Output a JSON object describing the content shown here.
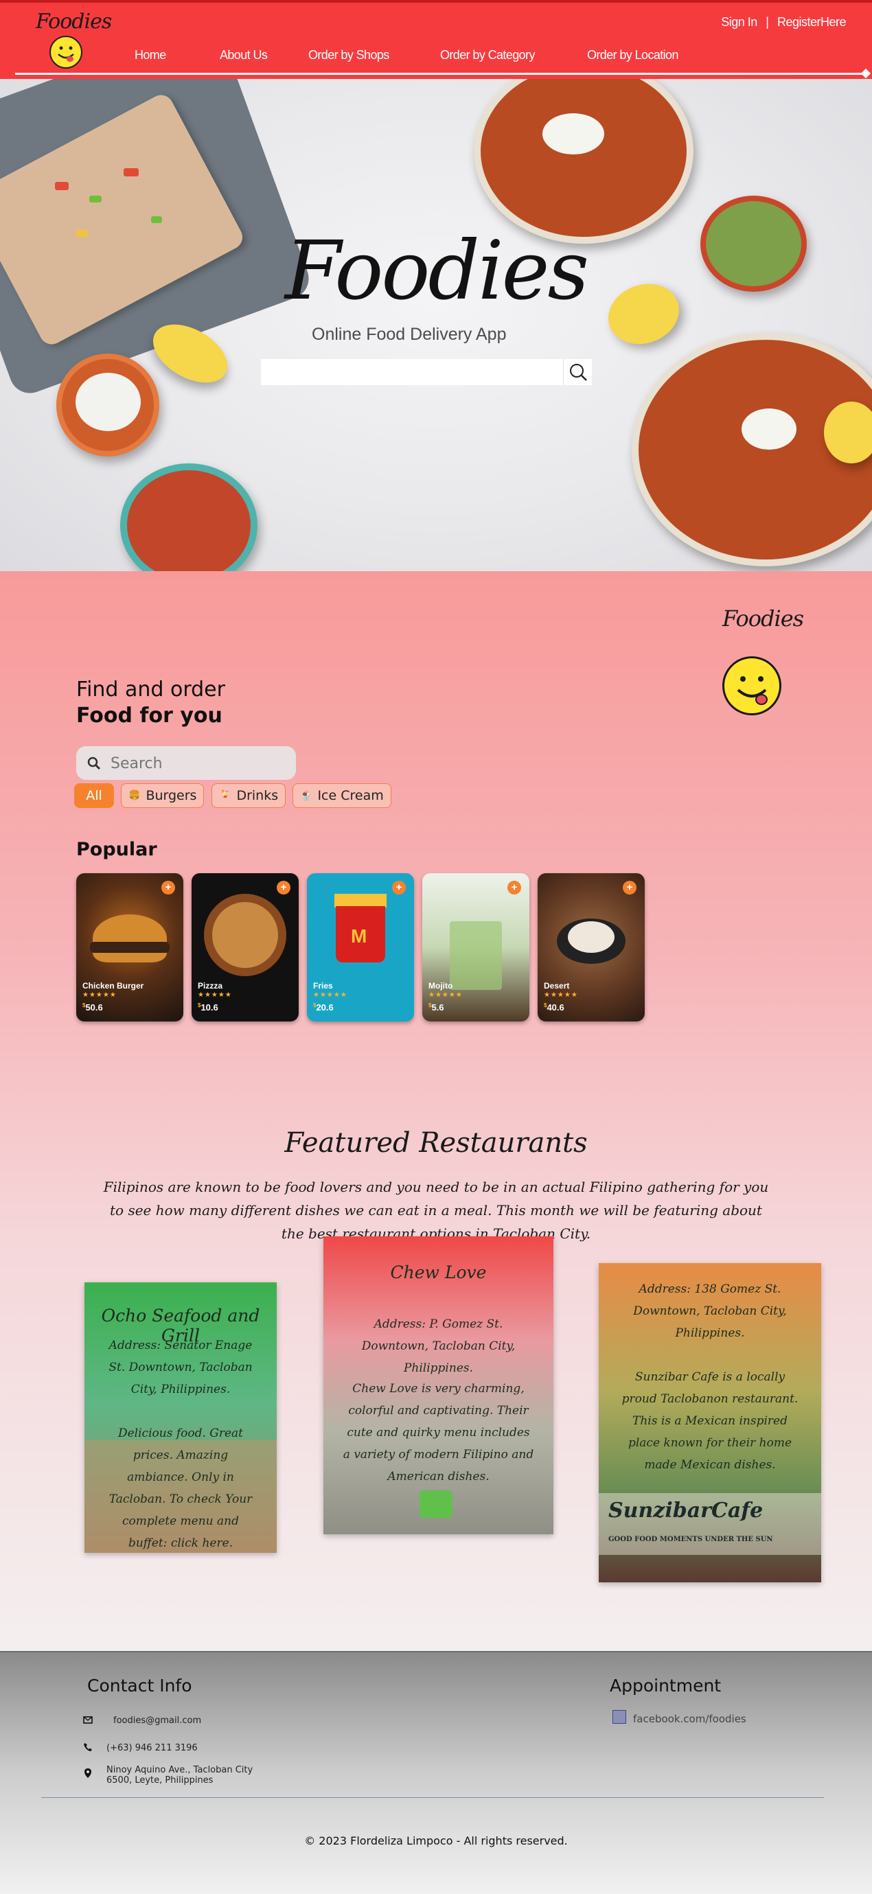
{
  "header": {
    "logo_text": "Foodies",
    "sign_in": "Sign In",
    "separator": "|",
    "register": "RegisterHere",
    "nav": [
      "Home",
      "About Us",
      "Order by Shops",
      "Order by Category",
      "Order by Location"
    ]
  },
  "hero": {
    "title": "Foodies",
    "subtitle": "Online Food Delivery App",
    "search_value": ""
  },
  "find": {
    "brand": "Foodies",
    "line1": "Find and order",
    "line2": "Food for you",
    "search_placeholder": "Search",
    "categories": [
      {
        "label": "All",
        "active": true
      },
      {
        "label": "Burgers",
        "active": false
      },
      {
        "label": "Drinks",
        "active": false
      },
      {
        "label": "Ice Cream",
        "active": false
      }
    ],
    "popular_title": "Popular",
    "items": [
      {
        "name": "Chicken Burger",
        "price": "50.6",
        "currency": "$",
        "plus": "+",
        "stars": "★★★★★"
      },
      {
        "name": "Pizzza",
        "price": "10.6",
        "currency": "$",
        "plus": "+",
        "stars": "★★★★★"
      },
      {
        "name": "Fries",
        "price": "20.6",
        "currency": "$",
        "plus": "+",
        "stars": "★★★★★"
      },
      {
        "name": "Mojito",
        "price": "5.6",
        "currency": "$",
        "plus": "+",
        "stars": "★★★★★"
      },
      {
        "name": "Desert",
        "price": "40.6",
        "currency": "$",
        "plus": "+",
        "stars": "★★★★★"
      }
    ]
  },
  "featured": {
    "title": "Featured Restaurants",
    "text": "Filipinos are known to be food lovers and you need to be in an actual Filipino gathering for you to see how many different dishes we can eat in a meal. This month we will be featuring about the best restaurant options in Tacloban City.",
    "restaurants": [
      {
        "name": "Ocho Seafood and Grill",
        "address": "Address: Senator Enage St. Downtown, Tacloban City, Philippines.",
        "desc": "Delicious food. Great prices. Amazing ambiance. Only in Tacloban. To check Your complete menu and buffet: click here."
      },
      {
        "name": "Chew Love",
        "address": "Address: P. Gomez St. Downtown, Tacloban City, Philippines.",
        "desc": "Chew Love is very charming, colorful and captivating. Their cute and quirky menu includes a variety of modern Filipino and American dishes."
      },
      {
        "name": "Sunzibar Cafe",
        "address": "Address: 138 Gomez St. Downtown, Tacloban City, Philippines.",
        "desc": "Sunzibar Cafe is a locally proud Taclobanon restaurant. This is a Mexican inspired place known for their home made Mexican dishes.",
        "sign_name": "SunzibarCafe",
        "sign_tagline": "GOOD FOOD MOMENTS UNDER THE SUN"
      }
    ]
  },
  "footer": {
    "contact_title": "Contact Info",
    "email": "foodies@gmail.com",
    "phone": "(+63) 946 211 3196",
    "address_line1": "Ninoy Aquino Ave., Tacloban City",
    "address_line2": "6500, Leyte, Philippines",
    "appointment_title": "Appointment",
    "facebook": "facebook.com/foodies",
    "copyright": "© 2023 Flordeliza Limpoco - All rights reserved."
  },
  "colors": {
    "header_red": "#f63b3f",
    "accent_orange": "#f6822e",
    "star_yellow": "#ffb22c"
  }
}
